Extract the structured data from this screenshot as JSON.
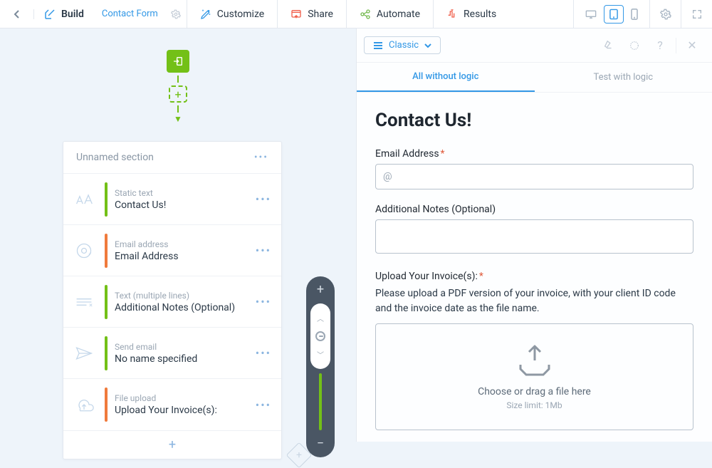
{
  "topbar": {
    "build_label": "Build",
    "form_name": "Contact Form",
    "items": {
      "customize": "Customize",
      "share": "Share",
      "automate": "Automate",
      "results": "Results"
    }
  },
  "builder": {
    "section_title": "Unnamed section",
    "fields": [
      {
        "type_label": "Static text",
        "title": "Contact Us!",
        "bar": "#73c017"
      },
      {
        "type_label": "Email address",
        "title": "Email Address",
        "bar": "#f07a3c"
      },
      {
        "type_label": "Text (multiple lines)",
        "title": "Additional Notes (Optional)",
        "bar": "#73c017"
      },
      {
        "type_label": "Send email",
        "title": "No name specified",
        "bar": "#73c017"
      },
      {
        "type_label": "File upload",
        "title": "Upload Your Invoice(s):",
        "bar": "#f07a3c"
      }
    ]
  },
  "right": {
    "classic_label": "Classic",
    "tabs": {
      "all": "All without logic",
      "test": "Test with logic"
    }
  },
  "preview": {
    "heading": "Contact Us!",
    "email": {
      "label": "Email Address",
      "required": true,
      "placeholder": "@"
    },
    "notes": {
      "label": "Additional Notes (Optional)",
      "required": false
    },
    "upload": {
      "label": "Upload Your Invoice(s):",
      "required": true,
      "help": "Please upload a PDF version of your invoice, with your client ID code and the invoice date as the file name.",
      "box_main": "Choose or drag a file here",
      "box_sub": "Size limit: 1Mb"
    }
  }
}
